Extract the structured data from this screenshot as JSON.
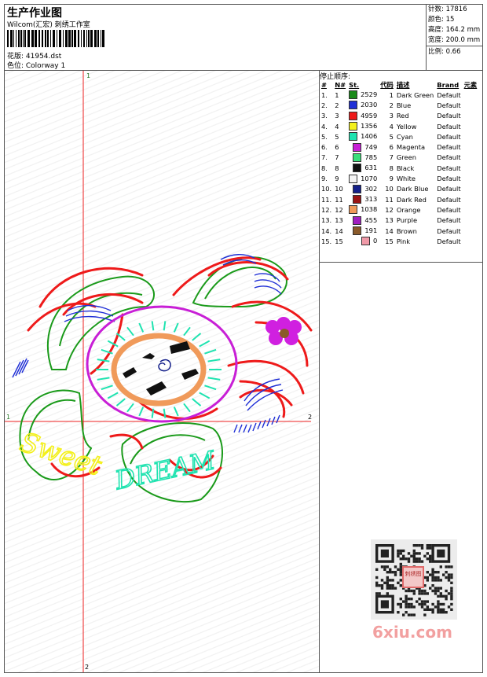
{
  "header": {
    "title": "生产作业图",
    "company": "Wilcom(汇宏) 刺绣工作室",
    "design_label": "花版: 41954.dst",
    "colorway_label": "色位: Colorway 1"
  },
  "stats": {
    "stitches": "针数: 17816",
    "colors": "颜色: 15",
    "height": "高度: 164.2 mm",
    "width": "宽度: 200.0 mm",
    "scale": "比例: 0.66"
  },
  "stop_sequence": {
    "title": "停止顺序:",
    "columns": [
      "#",
      "N#",
      "St.",
      "代码",
      "描述",
      "Brand",
      "元素"
    ],
    "rows": [
      {
        "idx": "1.",
        "n": "1",
        "st": "2529",
        "code": "1",
        "desc": "Dark Green",
        "brand": "Default",
        "color": "#1a8a1a"
      },
      {
        "idx": "2.",
        "n": "2",
        "st": "2030",
        "code": "2",
        "desc": "Blue",
        "brand": "Default",
        "color": "#1f2fd6"
      },
      {
        "idx": "3.",
        "n": "3",
        "st": "4959",
        "code": "3",
        "desc": "Red",
        "brand": "Default",
        "color": "#ee1a1a"
      },
      {
        "idx": "4.",
        "n": "4",
        "st": "1356",
        "code": "4",
        "desc": "Yellow",
        "brand": "Default",
        "color": "#f3f01b"
      },
      {
        "idx": "5.",
        "n": "5",
        "st": "1406",
        "code": "5",
        "desc": "Cyan",
        "brand": "Default",
        "color": "#1fe3b0"
      },
      {
        "idx": "6.",
        "n": "6",
        "st": "749",
        "code": "6",
        "desc": "Magenta",
        "brand": "Default",
        "color": "#c81fd6"
      },
      {
        "idx": "7.",
        "n": "7",
        "st": "785",
        "code": "7",
        "desc": "Green",
        "brand": "Default",
        "color": "#3adf7a"
      },
      {
        "idx": "8.",
        "n": "8",
        "st": "631",
        "code": "8",
        "desc": "Black",
        "brand": "Default",
        "color": "#111111"
      },
      {
        "idx": "9.",
        "n": "9",
        "st": "1070",
        "code": "9",
        "desc": "White",
        "brand": "Default",
        "color": "#f4f4f4"
      },
      {
        "idx": "10.",
        "n": "10",
        "st": "302",
        "code": "10",
        "desc": "Dark Blue",
        "brand": "Default",
        "color": "#14208a"
      },
      {
        "idx": "11.",
        "n": "11",
        "st": "313",
        "code": "11",
        "desc": "Dark Red",
        "brand": "Default",
        "color": "#9a1414"
      },
      {
        "idx": "12.",
        "n": "12",
        "st": "1038",
        "code": "12",
        "desc": "Orange",
        "brand": "Default",
        "color": "#f09a5a"
      },
      {
        "idx": "13.",
        "n": "13",
        "st": "455",
        "code": "13",
        "desc": "Purple",
        "brand": "Default",
        "color": "#a01fc0"
      },
      {
        "idx": "14.",
        "n": "14",
        "st": "191",
        "code": "14",
        "desc": "Brown",
        "brand": "Default",
        "color": "#8a5a2a"
      },
      {
        "idx": "15.",
        "n": "15",
        "st": "0",
        "code": "15",
        "desc": "Pink",
        "brand": "Default",
        "color": "#f09aa8"
      }
    ]
  },
  "axes": {
    "top_label": "1",
    "left_label": "1",
    "right_label": "2",
    "bottom_label": "2"
  },
  "embroidery_text": {
    "word1": "Sweet",
    "word2": "DREAM"
  },
  "watermark": "6xiu.com",
  "seal_text": "刺绣图",
  "colors": {
    "axis": "#ee2222",
    "border": "#555555"
  }
}
